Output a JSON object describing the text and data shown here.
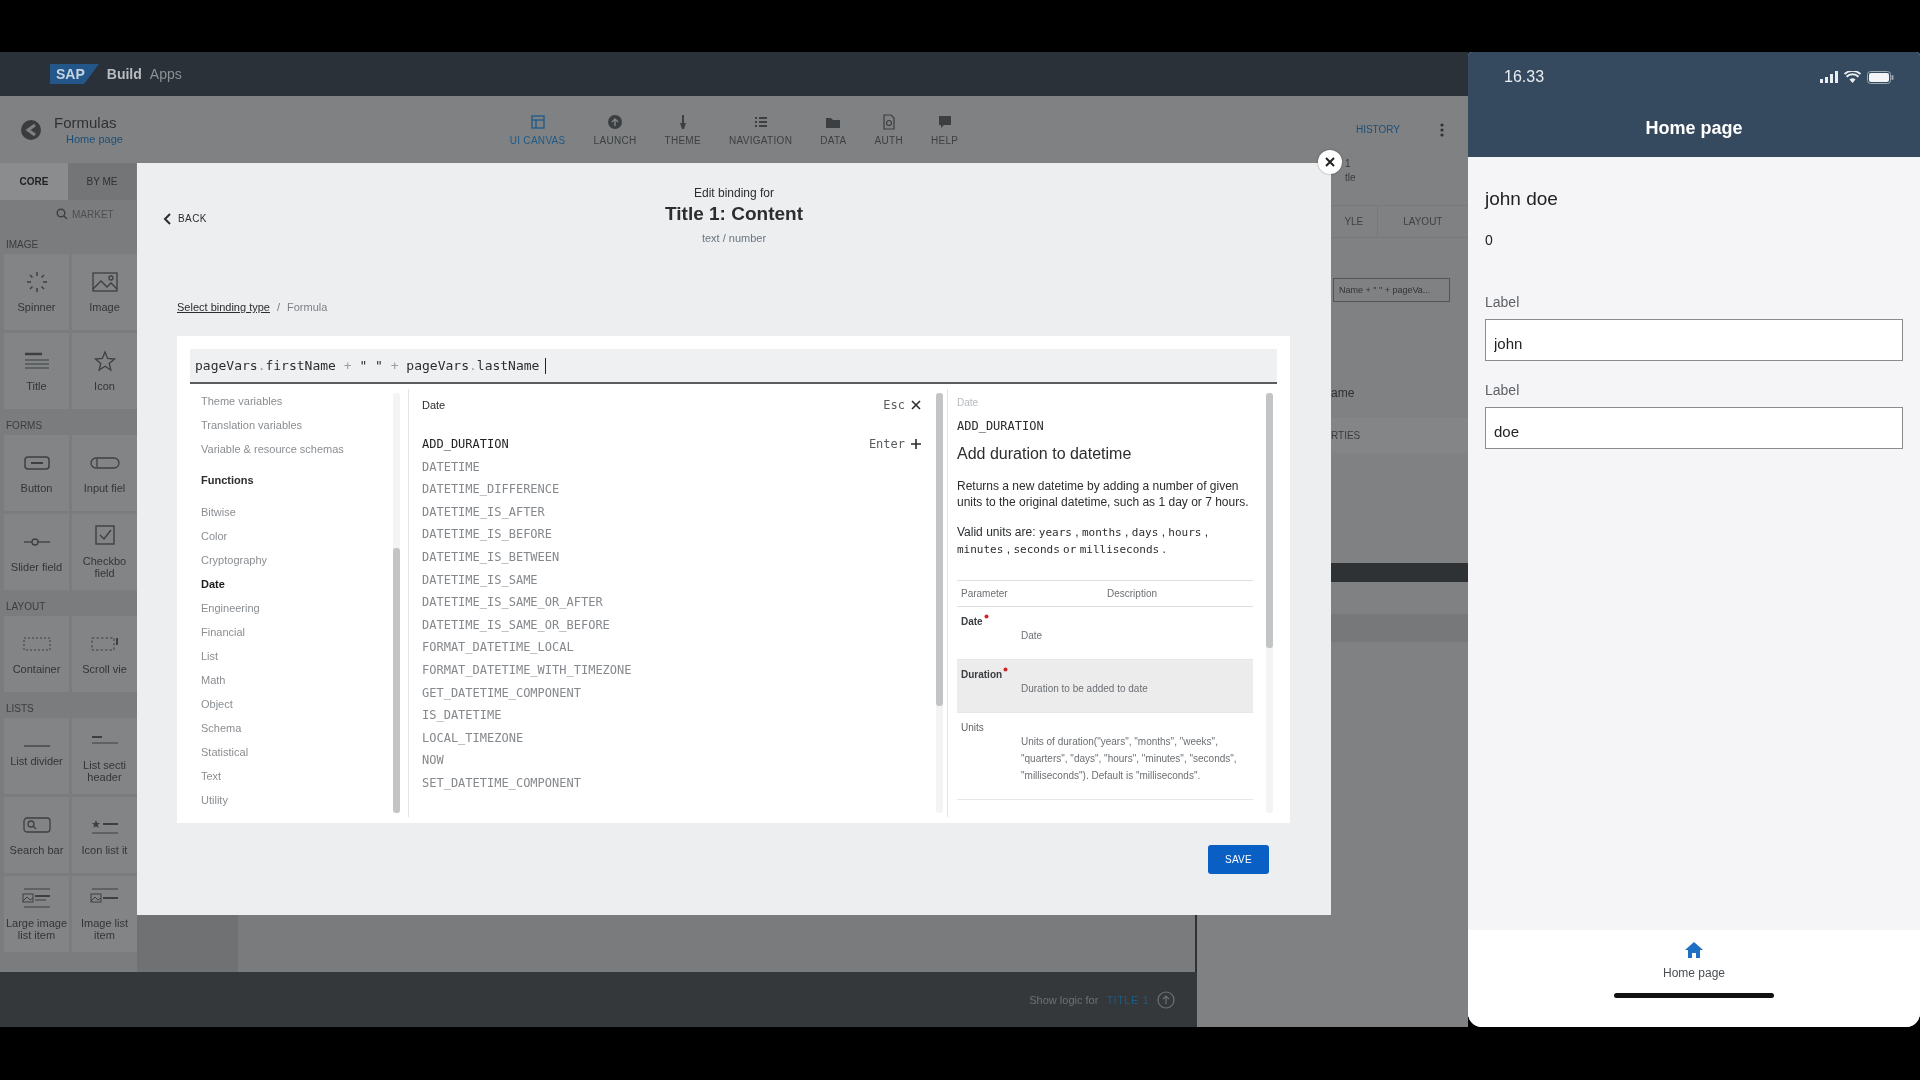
{
  "app_bar": {
    "logo": "SAP",
    "product": "Build",
    "suffix": "Apps"
  },
  "header": {
    "title": "Formulas",
    "breadcrumb": "Home page",
    "history": "HISTORY",
    "tabs": [
      {
        "label": "UI CANVAS",
        "kind": "canvas",
        "selected": true
      },
      {
        "label": "LAUNCH",
        "kind": "launch",
        "selected": false
      },
      {
        "label": "THEME",
        "kind": "theme",
        "selected": false
      },
      {
        "label": "NAVIGATION",
        "kind": "navigation",
        "selected": false
      },
      {
        "label": "DATA",
        "kind": "data",
        "selected": false
      },
      {
        "label": "AUTH",
        "kind": "auth",
        "selected": false
      },
      {
        "label": "HELP",
        "kind": "help",
        "selected": false
      }
    ]
  },
  "palette": {
    "tabs": [
      {
        "label": "CORE",
        "selected": true
      },
      {
        "label": "BY ME",
        "selected": false
      }
    ],
    "search": {
      "placeholder": "MARKET"
    },
    "sections": [
      {
        "title": "IMAGE",
        "items": [
          {
            "label": "Spinner",
            "kind": "spinner"
          },
          {
            "label": "Image",
            "kind": "image"
          },
          {
            "label": "Title",
            "kind": "title"
          },
          {
            "label": "Icon",
            "kind": "icon"
          }
        ]
      },
      {
        "title": "FORMS",
        "items": [
          {
            "label": "Button",
            "kind": "button"
          },
          {
            "label": "Input fiel",
            "kind": "input"
          },
          {
            "label": "Slider field",
            "kind": "slider"
          },
          {
            "label": "Checkbo field",
            "kind": "checkbox"
          }
        ]
      },
      {
        "title": "LAYOUT",
        "items": [
          {
            "label": "Container",
            "kind": "container"
          },
          {
            "label": "Scroll vie",
            "kind": "scroll"
          }
        ]
      },
      {
        "title": "LISTS",
        "items": [
          {
            "label": "List divider",
            "kind": "divider"
          },
          {
            "label": "List secti header",
            "kind": "section"
          },
          {
            "label": "Search bar",
            "kind": "searchbar"
          },
          {
            "label": "Icon list it",
            "kind": "iconlist"
          },
          {
            "label": "Large image list item",
            "kind": "largeimage"
          },
          {
            "label": "Image list item",
            "kind": "imagelist"
          }
        ]
      }
    ]
  },
  "right_panel": {
    "title_fragment": "1",
    "subtitle_fragment": "tle",
    "tabs": [
      "YLE",
      "LAYOUT"
    ],
    "field_value": "Name + \" \" + pageVa...",
    "label": "ame",
    "section": "RTIES"
  },
  "bottom_bar": {
    "text": "Show logic for",
    "target": "TITLE 1"
  },
  "modal": {
    "back": "BACK",
    "kicker": "Edit binding for",
    "title": "Title 1: Content",
    "subtitle": "text / number",
    "breadcrumb": [
      {
        "label": "Select binding type",
        "kind": "link"
      },
      {
        "label": "/",
        "kind": "separator"
      },
      {
        "label": "Formula",
        "kind": "current"
      }
    ],
    "formula": [
      {
        "text": "pageVars",
        "kind": "ident"
      },
      {
        "text": ".",
        "kind": "op"
      },
      {
        "text": "firstName",
        "kind": "ident"
      },
      {
        "text": " + ",
        "kind": "op"
      },
      {
        "text": "\" \"",
        "kind": "ident"
      },
      {
        "text": " + ",
        "kind": "op"
      },
      {
        "text": "pageVars",
        "kind": "ident"
      },
      {
        "text": ".",
        "kind": "op"
      },
      {
        "text": "lastName",
        "kind": "ident"
      }
    ],
    "categories": [
      {
        "label": "Theme variables",
        "kind": "item",
        "selected": false
      },
      {
        "label": "Translation variables",
        "kind": "item",
        "selected": false
      },
      {
        "label": "Variable & resource schemas",
        "kind": "item",
        "selected": false
      },
      {
        "label": "Functions",
        "kind": "heading"
      },
      {
        "label": "Bitwise",
        "kind": "item",
        "selected": false
      },
      {
        "label": "Color",
        "kind": "item",
        "selected": false
      },
      {
        "label": "Cryptography",
        "kind": "item",
        "selected": false
      },
      {
        "label": "Date",
        "kind": "item",
        "selected": true
      },
      {
        "label": "Engineering",
        "kind": "item",
        "selected": false
      },
      {
        "label": "Financial",
        "kind": "item",
        "selected": false
      },
      {
        "label": "List",
        "kind": "item",
        "selected": false
      },
      {
        "label": "Math",
        "kind": "item",
        "selected": false
      },
      {
        "label": "Object",
        "kind": "item",
        "selected": false
      },
      {
        "label": "Schema",
        "kind": "item",
        "selected": false
      },
      {
        "label": "Statistical",
        "kind": "item",
        "selected": false
      },
      {
        "label": "Text",
        "kind": "item",
        "selected": false
      },
      {
        "label": "Utility",
        "kind": "item",
        "selected": false
      }
    ],
    "functions": {
      "header": "Date",
      "esc": "Esc",
      "enter": "Enter",
      "items": [
        {
          "name": "ADD_DURATION",
          "selected": true
        },
        {
          "name": "DATETIME",
          "selected": false
        },
        {
          "name": "DATETIME_DIFFERENCE",
          "selected": false
        },
        {
          "name": "DATETIME_IS_AFTER",
          "selected": false
        },
        {
          "name": "DATETIME_IS_BEFORE",
          "selected": false
        },
        {
          "name": "DATETIME_IS_BETWEEN",
          "selected": false
        },
        {
          "name": "DATETIME_IS_SAME",
          "selected": false
        },
        {
          "name": "DATETIME_IS_SAME_OR_AFTER",
          "selected": false
        },
        {
          "name": "DATETIME_IS_SAME_OR_BEFORE",
          "selected": false
        },
        {
          "name": "FORMAT_DATETIME_LOCAL",
          "selected": false
        },
        {
          "name": "FORMAT_DATETIME_WITH_TIMEZONE",
          "selected": false
        },
        {
          "name": "GET_DATETIME_COMPONENT",
          "selected": false
        },
        {
          "name": "IS_DATETIME",
          "selected": false
        },
        {
          "name": "LOCAL_TIMEZONE",
          "selected": false
        },
        {
          "name": "NOW",
          "selected": false
        },
        {
          "name": "SET_DATETIME_COMPONENT",
          "selected": false
        }
      ]
    },
    "detail": {
      "category": "Date",
      "name": "ADD_DURATION",
      "title": "Add duration to datetime",
      "description": "Returns a new datetime by adding a number of given units to the original datetime, such as 1 day or 7 hours.",
      "units": [
        {
          "text": "Valid units are:",
          "kind": "text"
        },
        {
          "text": "years",
          "kind": "code"
        },
        {
          "text": ",",
          "kind": "text"
        },
        {
          "text": "months",
          "kind": "code"
        },
        {
          "text": ",",
          "kind": "text"
        },
        {
          "text": "days",
          "kind": "code"
        },
        {
          "text": ",",
          "kind": "text"
        },
        {
          "text": "hours",
          "kind": "code"
        },
        {
          "text": ",",
          "kind": "text"
        },
        {
          "text": "minutes",
          "kind": "code"
        },
        {
          "text": ",",
          "kind": "text"
        },
        {
          "text": "seconds",
          "kind": "code"
        },
        {
          "text": "or",
          "kind": "code"
        },
        {
          "text": "milliseconds",
          "kind": "code"
        },
        {
          "text": ".",
          "kind": "text"
        }
      ],
      "columns": [
        "Parameter",
        "Description"
      ],
      "params": [
        {
          "name": "Date",
          "required": true,
          "description": "Date",
          "selected": false
        },
        {
          "name": "Duration",
          "required": true,
          "description": "Duration to be added to date",
          "selected": true
        },
        {
          "name": "Units",
          "required": false,
          "description": "Units of duration(\"years\", \"months\", \"weeks\", \"quarters\", \"days\", \"hours\", \"minutes\", \"seconds\", \"milliseconds\"). Default is \"milliseconds\".",
          "selected": false
        }
      ]
    },
    "save": "SAVE"
  },
  "phone": {
    "time": "16.33",
    "title": "Home page",
    "heading": "john doe",
    "counter": "0",
    "fields": [
      {
        "label": "Label",
        "value": "john"
      },
      {
        "label": "Label",
        "value": "doe"
      }
    ],
    "tabs": [
      {
        "label": "Home page",
        "kind": "home",
        "selected": true
      }
    ]
  }
}
